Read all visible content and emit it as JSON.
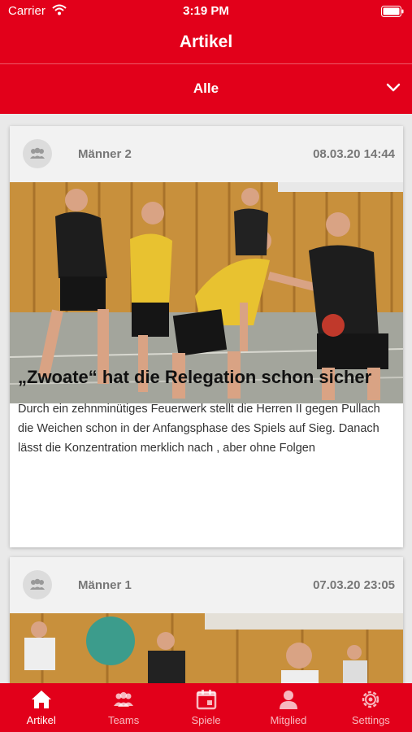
{
  "status_bar": {
    "carrier": "Carrier",
    "time": "3:19 PM"
  },
  "header": {
    "title": "Artikel"
  },
  "filter": {
    "label": "Alle"
  },
  "articles": [
    {
      "team": "Männer 2",
      "date": "08.03.20 14:44",
      "title": "„Zwoate“ hat die Relegation schon sicher",
      "excerpt": "Durch ein zehnminütiges Feuerwerk stellt die Herren II gegen Pullach die Weichen schon in der Anfangsphase des Spiels auf Sieg. Danach lässt die Konzentration merklich nach , aber ohne Folgen"
    },
    {
      "team": "Männer 1",
      "date": "07.03.20 23:05"
    }
  ],
  "tabbar": {
    "items": [
      {
        "label": "Artikel",
        "icon": "home-icon"
      },
      {
        "label": "Teams",
        "icon": "teams-icon"
      },
      {
        "label": "Spiele",
        "icon": "calendar-icon"
      },
      {
        "label": "Mitglied",
        "icon": "person-icon"
      },
      {
        "label": "Settings",
        "icon": "gear-icon"
      }
    ]
  },
  "colors": {
    "brand": "#e2001a",
    "background": "#e9e9e9"
  }
}
